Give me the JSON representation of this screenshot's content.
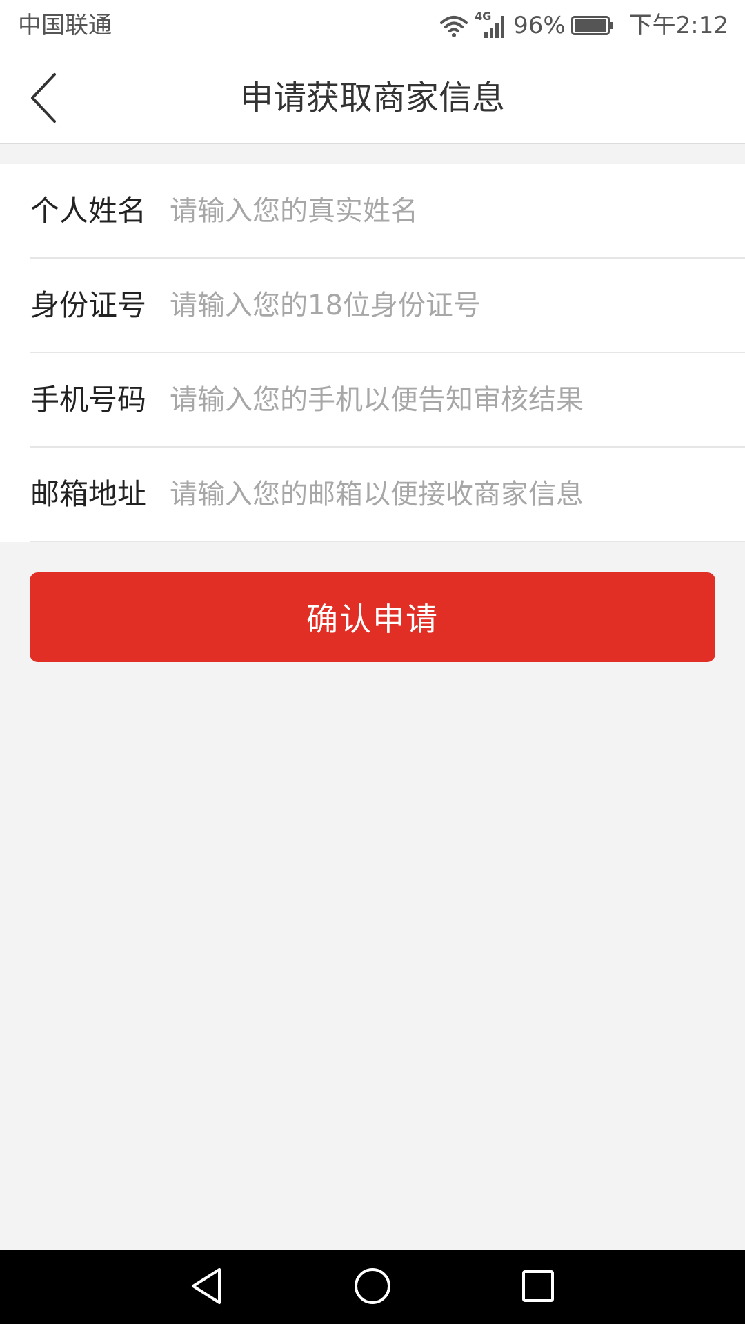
{
  "status_bar": {
    "carrier": "中国联通",
    "network": "4G",
    "battery": "96%",
    "time": "下午2:12",
    "icons": [
      "wifi-icon",
      "signal-icon",
      "battery-icon"
    ]
  },
  "header": {
    "title": "申请获取商家信息",
    "back_icon": "chevron-left-icon"
  },
  "form": {
    "fields": [
      {
        "label": "个人姓名",
        "placeholder": "请输入您的真实姓名",
        "value": ""
      },
      {
        "label": "身份证号",
        "placeholder": "请输入您的18位身份证号",
        "value": ""
      },
      {
        "label": "手机号码",
        "placeholder": "请输入您的手机以便告知审核结果",
        "value": ""
      },
      {
        "label": "邮箱地址",
        "placeholder": "请输入您的邮箱以便接收商家信息",
        "value": ""
      }
    ],
    "submit_label": "确认申请"
  },
  "nav": {
    "icons": [
      "back-triangle-icon",
      "home-circle-icon",
      "recents-square-icon"
    ]
  },
  "colors": {
    "accent": "#e12f26",
    "background": "#f3f3f3",
    "surface": "#ffffff",
    "placeholder": "#a7a7a7",
    "label": "#222222"
  }
}
